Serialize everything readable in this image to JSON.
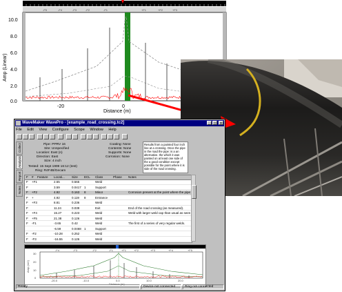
{
  "top_plot": {
    "ylabel": "Amp (Linear)",
    "xlabel": "Distance (m)",
    "y_ticks": [
      "10.0",
      "8.0",
      "6.0",
      "4.0",
      "2.0",
      "0.0"
    ],
    "x_ticks": [
      "-20",
      "0"
    ],
    "feature_markers": [
      "-F5",
      "-F4",
      "-F3",
      "-F2",
      "-F1",
      "+F1",
      "+F2",
      "+F3"
    ],
    "colors": {
      "trace": "#ff0000",
      "envelope": "#909090",
      "highlight": "#1e8a1e",
      "arrow": "#ff0000"
    }
  },
  "window": {
    "title": "WaveMaker WavePro - [example_road_crossing.tc2]",
    "menu": [
      "File",
      "Edit",
      "View",
      "Configure",
      "Scope",
      "Window",
      "Help"
    ],
    "side_tabs": [
      "Collect",
      "Analysis",
      "Report",
      "Notes"
    ],
    "info": {
      "pipe": "Pipe: PPRV 16",
      "site": "Site: Unspecified",
      "location": "Location: East (n)",
      "direction": "Direction: East",
      "size": "Size: 4 inch",
      "tested": "Tested: 15 Sept 1999 16:12 (test)",
      "ring": "Ring: R4F4B/Gecam",
      "coating": "Coating: None",
      "contents": "Contents: None",
      "supports": "Supports: None",
      "corrosion": "Corrosion: None"
    },
    "notes": "Results from a painted four inch line at a crossing. Once the pipe in the road the pipe: is a an alternative. the which it was painted on at least one side of the a good condition except possible for the point where it is side of the road crossing.",
    "table": {
      "headers": [
        "F",
        "#",
        "Feature",
        "Locati...",
        "Size",
        "ECL",
        "Class",
        "Phase",
        "Notes"
      ],
      "rows": [
        [
          "F",
          "+F1",
          "",
          "2.55",
          "0.565",
          "",
          "Weld",
          "",
          ""
        ],
        [
          "F",
          "",
          "",
          "3.59",
          "0.0417",
          "1",
          "Support",
          "",
          ""
        ],
        [
          "F",
          "+F2",
          "",
          "4.92",
          "0.163",
          "8",
          "Minor",
          "",
          "Corrosion present at the point where the pipe enters the roadway."
        ],
        [
          "F",
          "+",
          "",
          "4.92",
          "0.119",
          "8",
          "Entrance",
          "",
          ""
        ],
        [
          "F",
          "+F3",
          "",
          "8.81",
          "0.236",
          "",
          "Weld",
          "",
          ""
        ],
        [
          "F",
          "",
          "",
          "11.24",
          "0.039",
          "",
          "Exit",
          "",
          "End of the road crossing (as measured)."
        ],
        [
          "F",
          "+F4",
          "",
          "15.27",
          "0.223",
          "",
          "Weld",
          "",
          "Weld with larger weld cap than usual as seen from other side."
        ],
        [
          "F",
          "+F5",
          "",
          "21.38",
          "0.126",
          "",
          "Weld",
          "",
          ""
        ],
        [
          "F",
          "-F1",
          "",
          "-3.65",
          "0.42",
          "",
          "Weld",
          "",
          "The first of a series of very regular welds."
        ],
        [
          "",
          "",
          "",
          "-6.59",
          "0.0468",
          "1",
          "Support",
          "",
          ""
        ],
        [
          "F",
          "-F2",
          "",
          "-10.28",
          "0.252",
          "",
          "Weld",
          "",
          ""
        ],
        [
          "F",
          "-F3",
          "",
          "-16.55",
          "0.126",
          "",
          "Weld",
          "",
          ""
        ]
      ]
    },
    "lower_plot": {
      "ylabel": "Amp (mV)",
      "xlabel": "Distance (m)",
      "y_ticks": [
        "30",
        "20",
        "10",
        "0"
      ],
      "x_ticks": [
        "-20.0",
        "-10.0",
        "0.0",
        "10.0",
        "20.0"
      ],
      "markers": [
        "-F4",
        "-F3",
        "-F2",
        "-F1",
        "+F1",
        "+F2",
        "+F3",
        "+F4",
        "+F5"
      ]
    },
    "status": {
      "ready": "Ready",
      "device": "Device not connected",
      "ring": "Ring not connected"
    }
  }
}
